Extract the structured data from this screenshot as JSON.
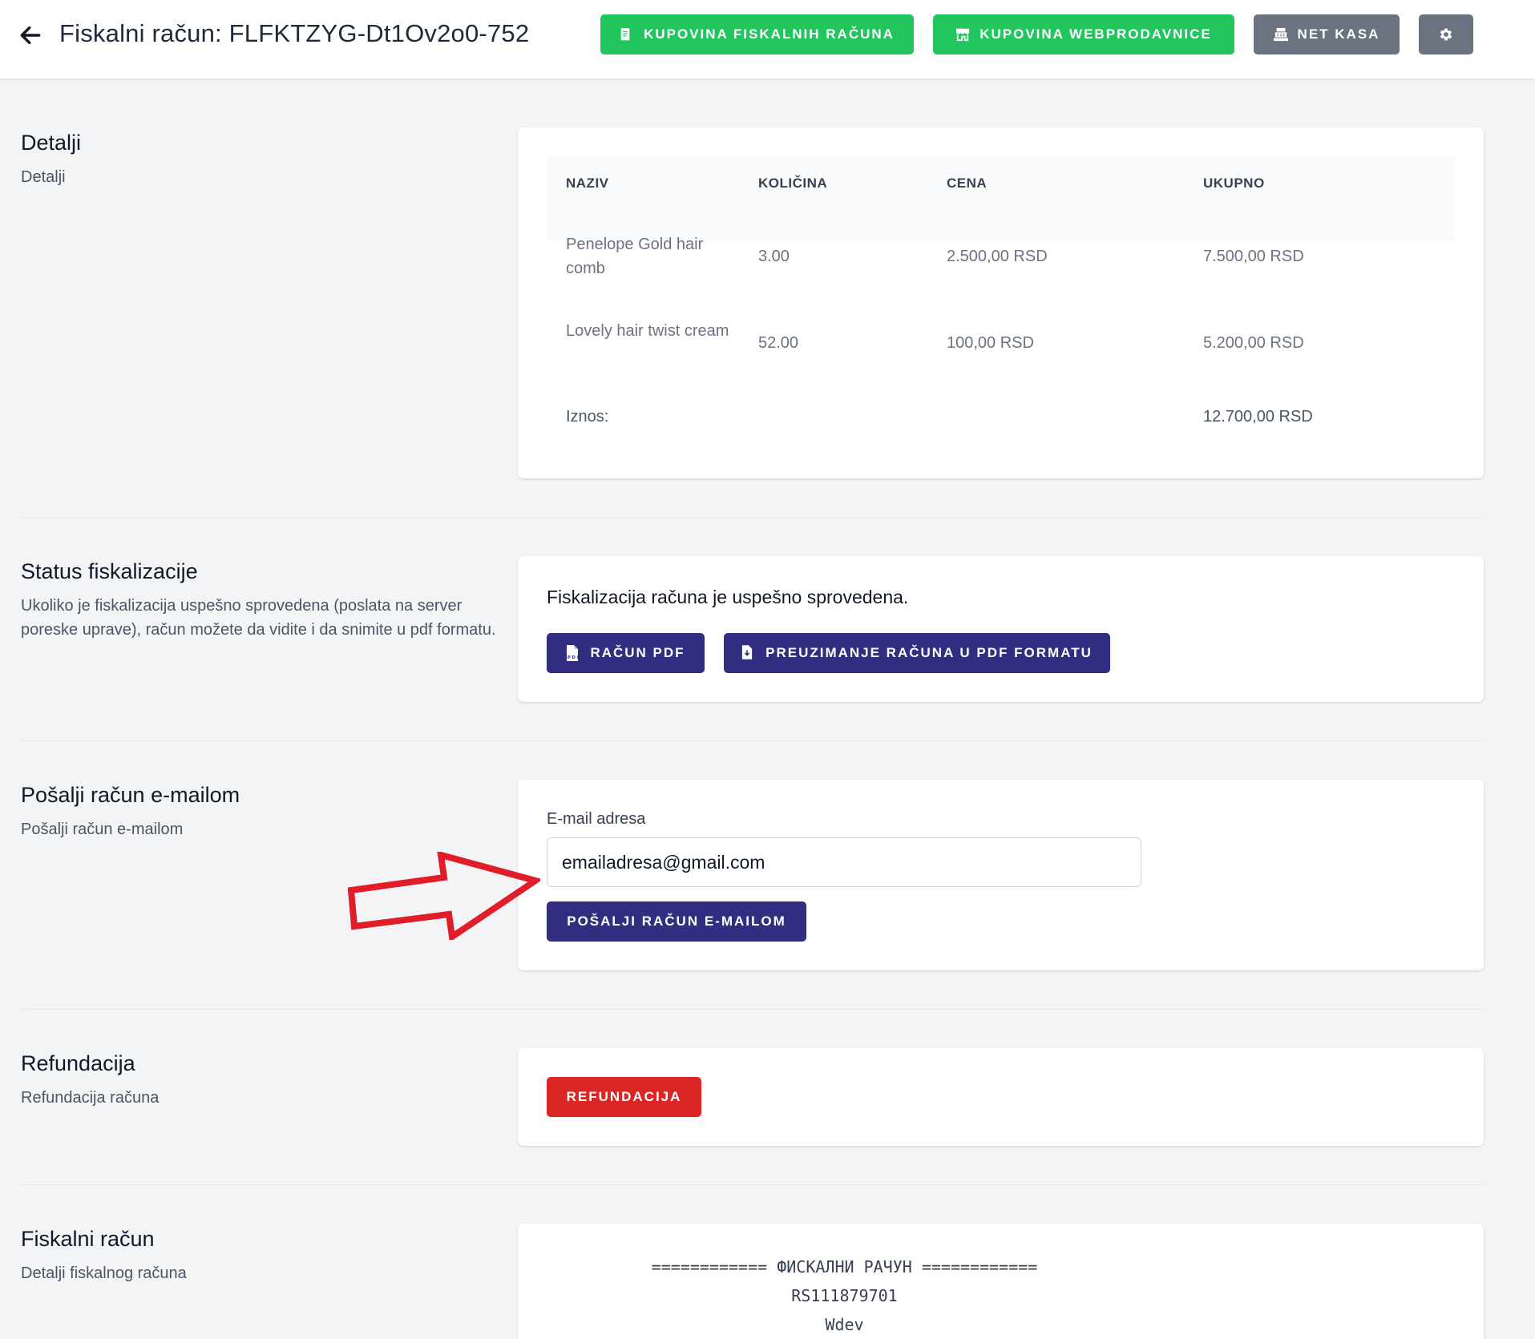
{
  "header": {
    "title": "Fiskalni račun: FLFKTZYG-Dt1Ov2o0-752",
    "buttons": {
      "kupovina_fiskalnih": "KUPOVINA FISKALNIH RAČUNA",
      "kupovina_web": "KUPOVINA WEBPRODAVNICE",
      "net_kasa": "NET KASA"
    }
  },
  "colors": {
    "green": "#22c55e",
    "gray": "#6b7280",
    "primary": "#312e81",
    "danger": "#dc2626",
    "arrow": "#e11d2a"
  },
  "detalji": {
    "title": "Detalji",
    "desc": "Detalji",
    "columns": [
      "NAZIV",
      "KOLIČINA",
      "CENA",
      "UKUPNO"
    ],
    "rows": [
      {
        "naziv": "Penelope Gold hair comb",
        "kolicina": "3.00",
        "cena": "2.500,00 RSD",
        "ukupno": "7.500,00 RSD"
      },
      {
        "naziv": "Lovely hair twist cream",
        "kolicina": "52.00",
        "cena": "100,00 RSD",
        "ukupno": "5.200,00 RSD"
      }
    ],
    "total_label": "Iznos:",
    "total_value": "12.700,00 RSD"
  },
  "status": {
    "title": "Status fiskalizacije",
    "desc": "Ukoliko je fiskalizacija uspešno sprovedena (poslata na server poreske uprave), račun možete da vidite i da snimite u pdf formatu.",
    "message": "Fiskalizacija računa je uspešno sprovedena.",
    "btn_pdf": "RAČUN PDF",
    "btn_download": "PREUZIMANJE RAČUNA U PDF FORMATU"
  },
  "email": {
    "title": "Pošalji račun e-mailom",
    "desc": "Pošalji račun e-mailom",
    "label": "E-mail adresa",
    "value": "emailadresa@gmail.com",
    "btn": "POŠALJI RAČUN E-MAILOM"
  },
  "refund": {
    "title": "Refundacija",
    "desc": "Refundacija računa",
    "btn": "REFUNDACIJA"
  },
  "fiskalni": {
    "title": "Fiskalni račun",
    "desc": "Detalji fiskalnog računa",
    "lines": [
      "============ ФИСКАЛНИ РАЧУН ============",
      "RS111879701",
      "Wdev"
    ]
  }
}
